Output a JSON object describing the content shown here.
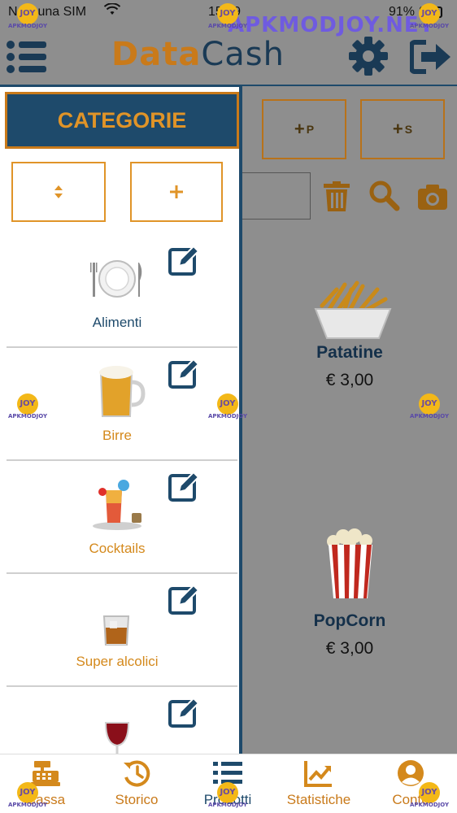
{
  "status_bar": {
    "carrier": "Nessuna SIM",
    "time": "15:09",
    "battery": "91%"
  },
  "header": {
    "brand_part1": "Data",
    "brand_part2": "Cash"
  },
  "toolbar": {
    "add_p_label": "P",
    "add_s_label": "S"
  },
  "drawer": {
    "title": "CATEGORIE",
    "categories": [
      {
        "label": "Alimenti",
        "color": "#1e4a6b",
        "icon": "plate-icon"
      },
      {
        "label": "Birre",
        "color": "#d4891c",
        "icon": "beer-icon"
      },
      {
        "label": "Cocktails",
        "color": "#d4891c",
        "icon": "cocktail-icon"
      },
      {
        "label": "Super alcolici",
        "color": "#d4891c",
        "icon": "whisky-icon"
      },
      {
        "label": "",
        "color": "#d4891c",
        "icon": "wine-icon"
      }
    ]
  },
  "products": [
    {
      "name": "Patatine",
      "price": "€ 3,00"
    },
    {
      "name": "PopCorn",
      "price": "€ 3,00"
    }
  ],
  "tabs": [
    {
      "label": "Cassa"
    },
    {
      "label": "Storico"
    },
    {
      "label": "Prodotti"
    },
    {
      "label": "Statistiche"
    },
    {
      "label": "Conto"
    }
  ],
  "watermark": {
    "site": "APKMODJOY.NET",
    "badge": "JOY",
    "caption": "APKMODJOY"
  },
  "colors": {
    "navy": "#1e4a6b",
    "orange": "#d4891c",
    "dim": "#8e8e8e"
  }
}
